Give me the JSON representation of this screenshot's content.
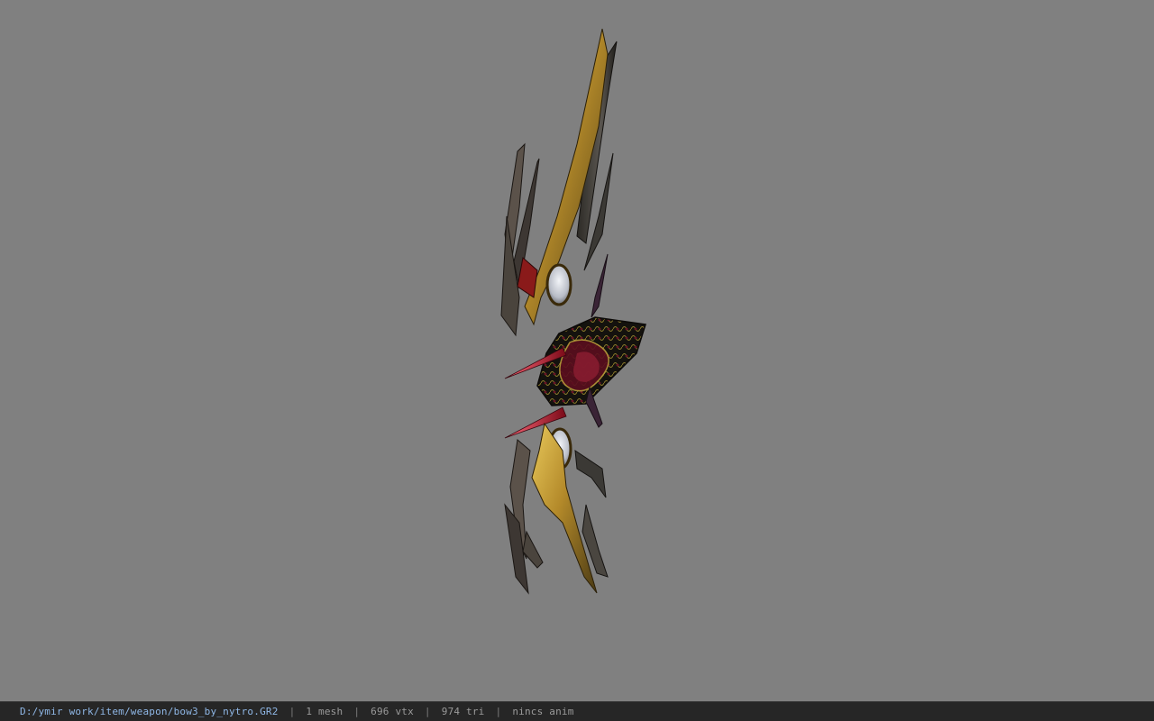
{
  "viewer": {
    "background_color": "#808080",
    "model_name": "bow3_by_nytro"
  },
  "status": {
    "path": "D:/ymir work/item/weapon/bow3_by_nytro.GR2",
    "separator": "|",
    "mesh_count": "1 mesh",
    "vertex_count": "696 vtx",
    "triangle_count": "974 tri",
    "animation": "nincs anim",
    "path_color": "#8fb7e6"
  }
}
